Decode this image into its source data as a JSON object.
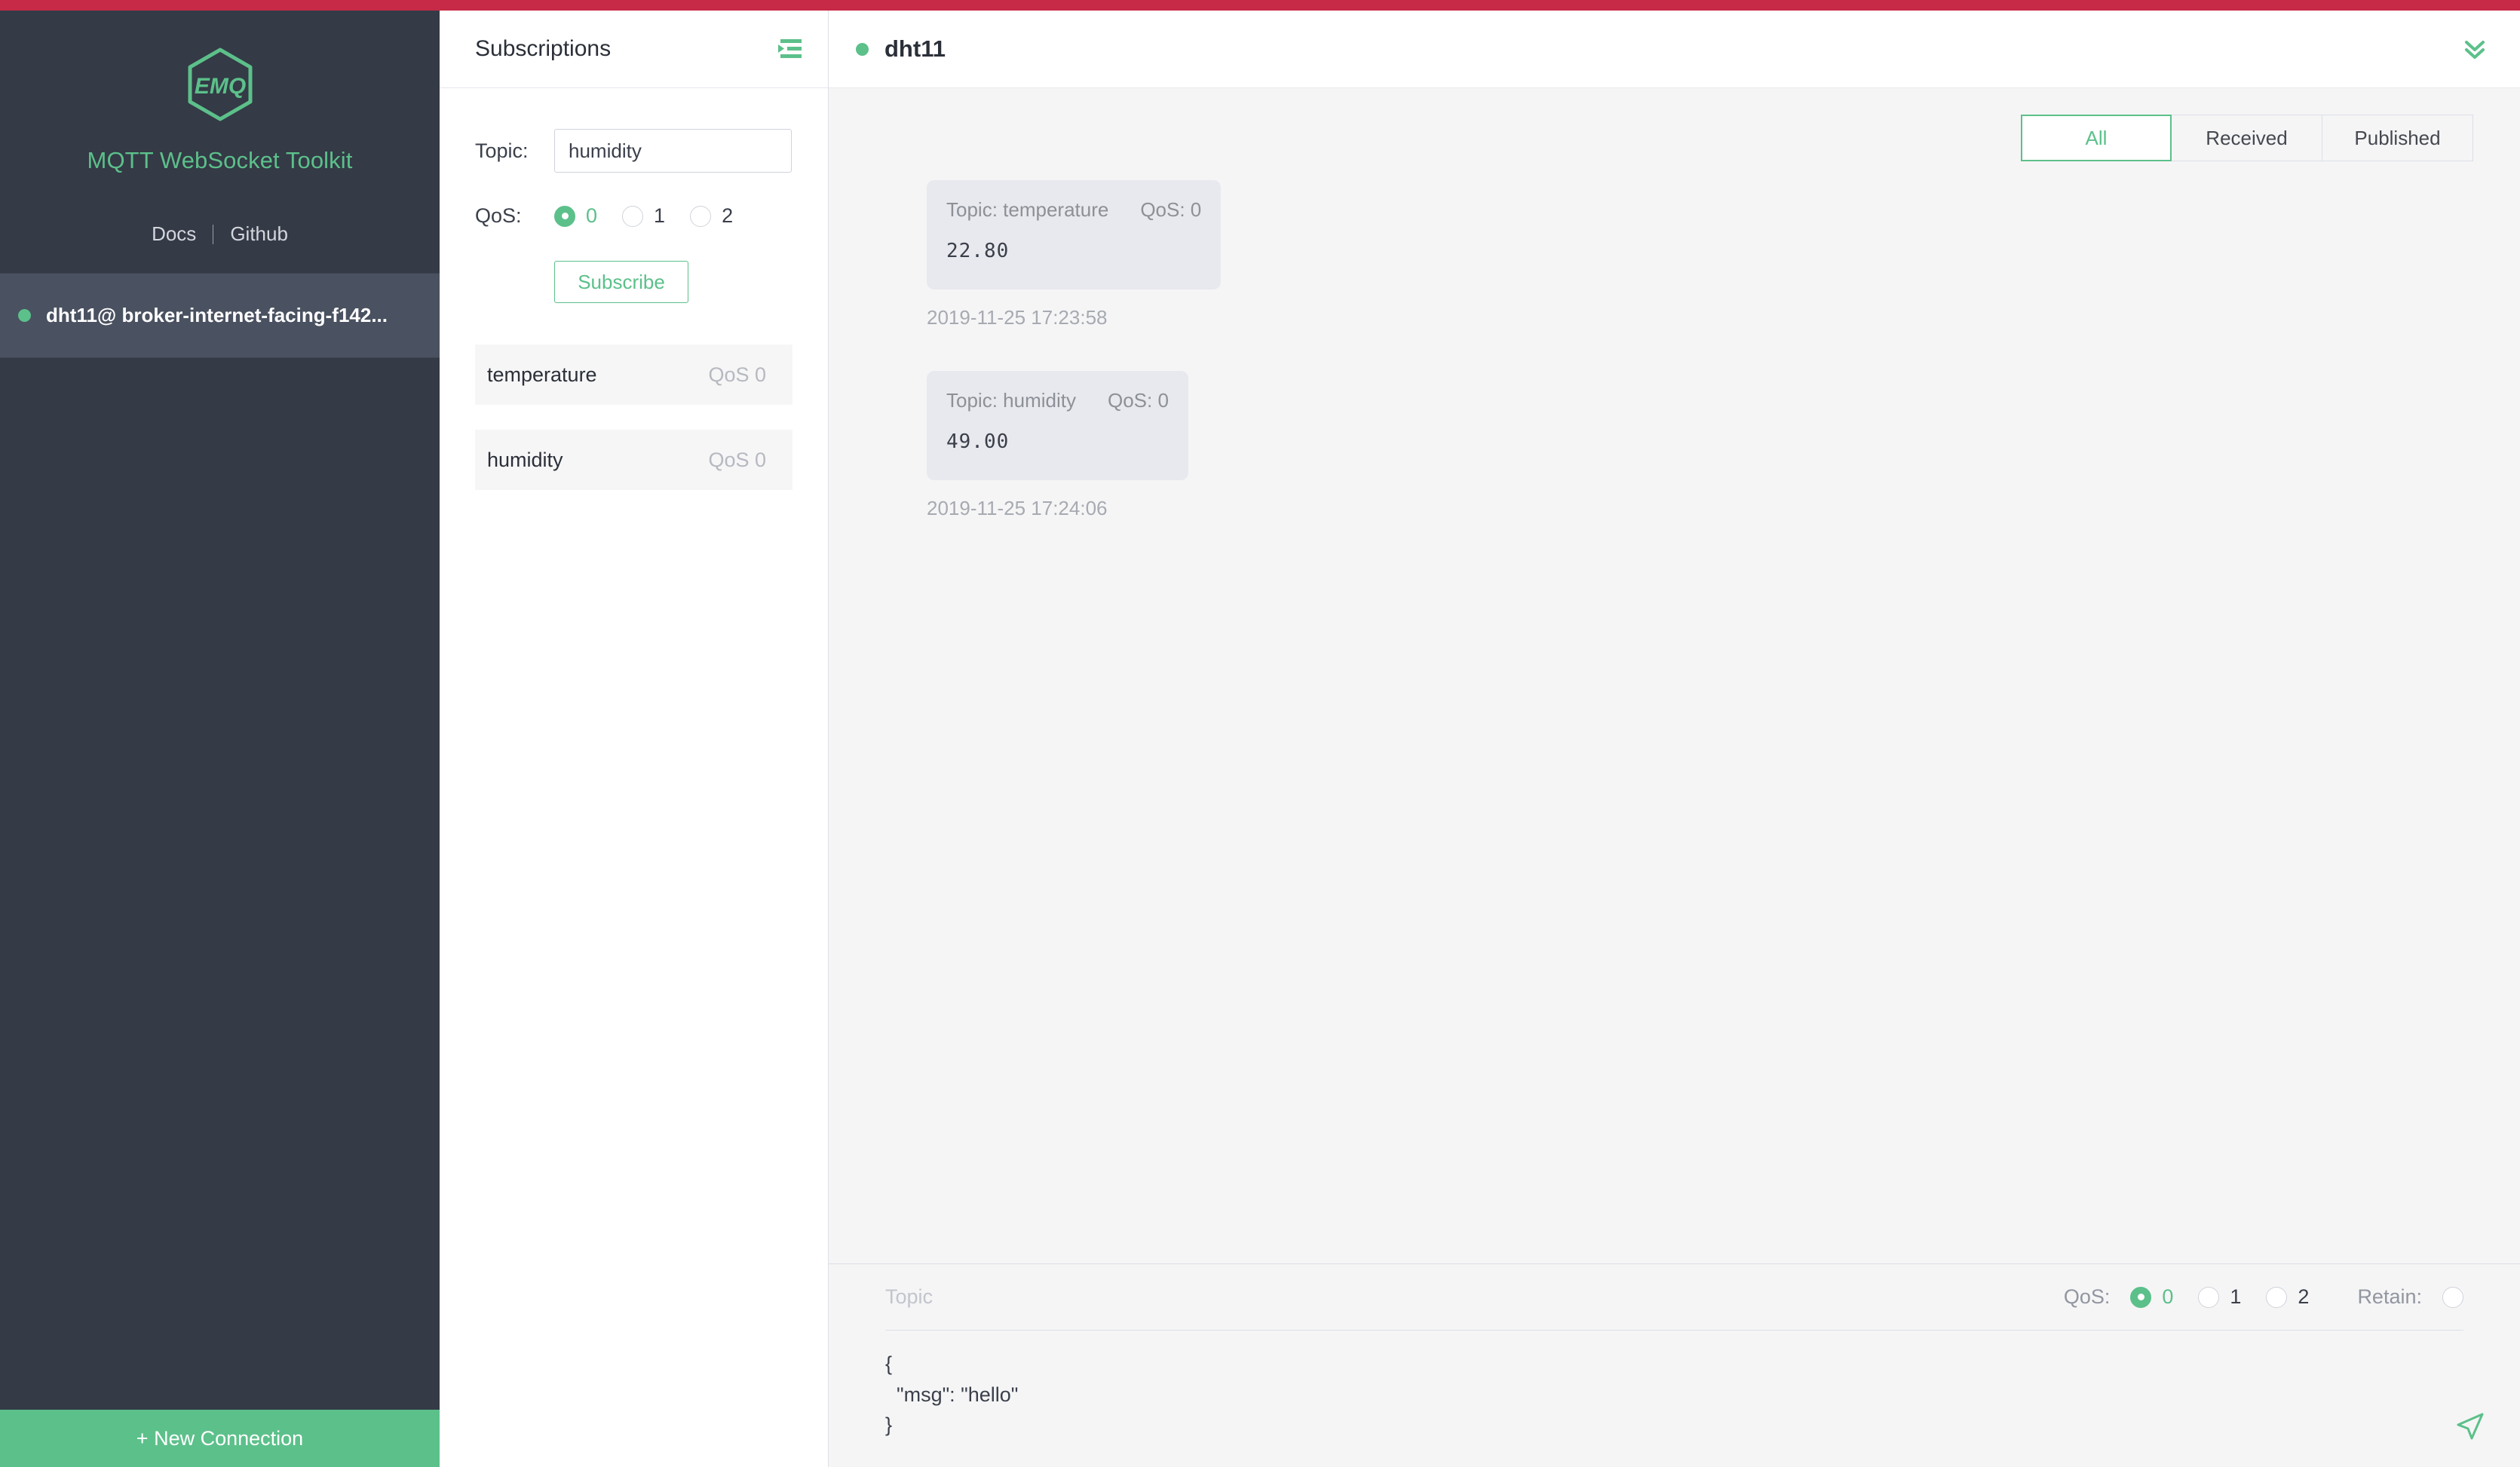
{
  "theme": {
    "accent_red": "#c62a47",
    "brand_green": "#5cc08a",
    "sidebar_bg": "#343a46",
    "sidebar_active_bg": "#4a5160",
    "message_area_bg": "#f5f5f6",
    "bubble_bg": "#e8e9ee"
  },
  "sidebar": {
    "logo_text": "EMQ",
    "brand_name": "MQTT WebSocket Toolkit",
    "links": {
      "docs": "Docs",
      "github": "Github"
    },
    "connections": [
      {
        "label": "dht11@ broker-internet-facing-f142...",
        "status": "connected",
        "active": true
      }
    ],
    "new_connection_label": "+ New Connection"
  },
  "subscriptions_panel": {
    "title": "Subscriptions",
    "collapse_icon": "indent-left-icon",
    "form": {
      "topic_label": "Topic:",
      "topic_value": "humidity",
      "topic_placeholder": "",
      "qos_label": "QoS:",
      "qos_options": [
        "0",
        "1",
        "2"
      ],
      "qos_selected": "0",
      "subscribe_label": "Subscribe"
    },
    "list": [
      {
        "topic": "temperature",
        "qos": "QoS 0"
      },
      {
        "topic": "humidity",
        "qos": "QoS 0"
      }
    ]
  },
  "main": {
    "connection_title": "dht11",
    "connection_status": "connected",
    "header_collapse_icon": "double-chevron-down-icon",
    "filter_tabs": [
      {
        "label": "All",
        "active": true
      },
      {
        "label": "Received",
        "active": false
      },
      {
        "label": "Published",
        "active": false
      }
    ],
    "messages": [
      {
        "topic_label": "Topic: temperature",
        "qos_label": "QoS: 0",
        "payload": "22.80",
        "timestamp": "2019-11-25 17:23:58"
      },
      {
        "topic_label": "Topic: humidity",
        "qos_label": "QoS: 0",
        "payload": "49.00",
        "timestamp": "2019-11-25 17:24:06"
      }
    ]
  },
  "publish_bar": {
    "topic_placeholder": "Topic",
    "topic_value": "",
    "qos_label": "QoS:",
    "qos_options": [
      "0",
      "1",
      "2"
    ],
    "qos_selected": "0",
    "retain_label": "Retain:",
    "retain_checked": false,
    "payload": "{\n  \"msg\": \"hello\"\n}",
    "send_icon": "send-paper-plane-icon"
  }
}
